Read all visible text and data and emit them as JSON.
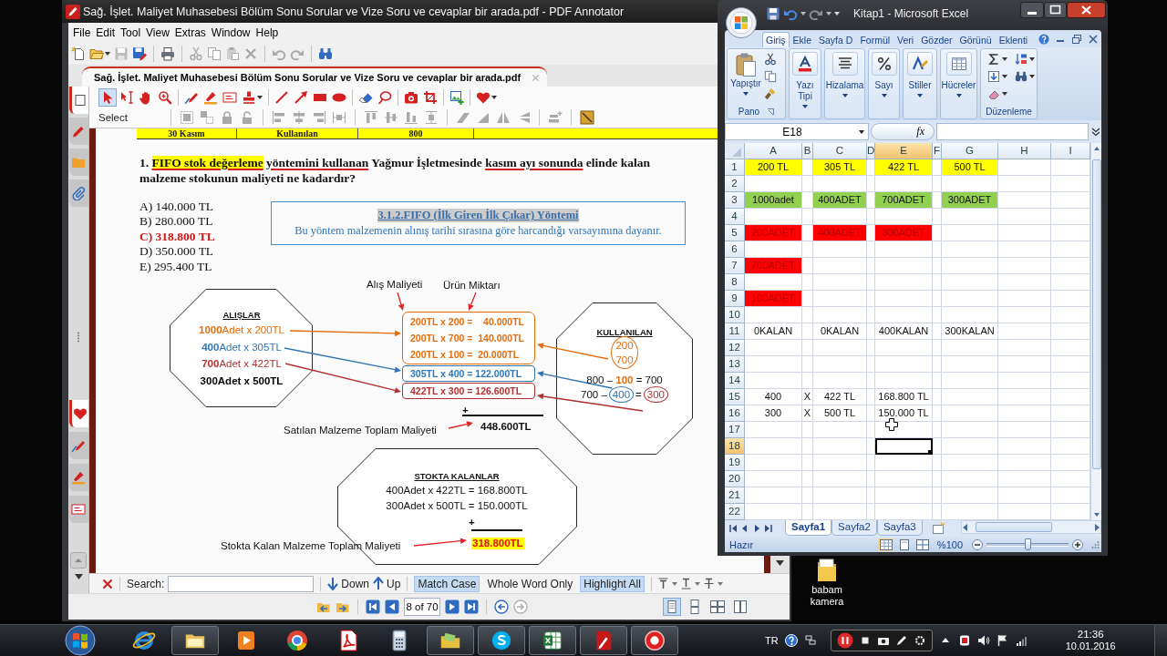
{
  "pdf_window": {
    "title": "Sağ. İşlet. Maliyet Muhasebesi Bölüm Sonu Sorular ve Vize Soru ve cevaplar bir arada.pdf - PDF Annotator",
    "menu": [
      "File",
      "Edit",
      "Tool",
      "View",
      "Extras",
      "Window",
      "Help"
    ],
    "toolbar": [
      {
        "kind": "new",
        "disabled": false,
        "dropdown": false
      },
      {
        "kind": "open",
        "disabled": false,
        "dropdown": true
      },
      {
        "kind": "save",
        "disabled": true,
        "dropdown": false
      },
      {
        "kind": "saveas",
        "disabled": false,
        "dropdown": false
      },
      {
        "kind": "separator"
      },
      {
        "kind": "print",
        "disabled": false,
        "dropdown": false
      },
      {
        "kind": "separator"
      },
      {
        "kind": "cut",
        "disabled": true,
        "dropdown": false
      },
      {
        "kind": "copy",
        "disabled": true,
        "dropdown": false
      },
      {
        "kind": "paste",
        "disabled": true,
        "dropdown": false
      },
      {
        "kind": "delete",
        "disabled": true,
        "dropdown": false
      },
      {
        "kind": "separator"
      },
      {
        "kind": "undo",
        "disabled": true,
        "dropdown": false
      },
      {
        "kind": "redo",
        "disabled": true,
        "dropdown": false
      },
      {
        "kind": "separator"
      },
      {
        "kind": "find",
        "disabled": false,
        "dropdown": false
      }
    ],
    "document_tab": "Sağ. İşlet. Maliyet Muhasebesi Bölüm Sonu Sorular ve Vize Soru ve cevaplar bir arada.pdf",
    "side_tabs": [
      {
        "kind": "page",
        "selected": true
      },
      {
        "kind": "marker",
        "selected": false
      },
      {
        "kind": "folder",
        "selected": false
      },
      {
        "kind": "clip",
        "selected": false
      }
    ],
    "side_tools": [
      {
        "kind": "heart",
        "selected": true
      },
      {
        "kind": "pen",
        "selected": false
      },
      {
        "kind": "highlighter",
        "selected": false
      },
      {
        "kind": "textbox",
        "selected": false
      }
    ],
    "tools": [
      {
        "kind": "pointer",
        "selected": true,
        "dropdown": false
      },
      {
        "kind": "textselect",
        "selected": false,
        "dropdown": false
      },
      {
        "kind": "hand",
        "selected": false,
        "dropdown": false
      },
      {
        "kind": "zoom",
        "selected": false,
        "dropdown": false
      },
      {
        "kind": "separator"
      },
      {
        "kind": "pen",
        "selected": false,
        "dropdown": false
      },
      {
        "kind": "highlighter",
        "selected": false,
        "dropdown": false
      },
      {
        "kind": "textbox",
        "selected": false,
        "dropdown": false
      },
      {
        "kind": "stamp",
        "selected": false,
        "dropdown": true
      },
      {
        "kind": "separator"
      },
      {
        "kind": "line",
        "selected": false,
        "dropdown": false
      },
      {
        "kind": "arrow",
        "selected": false,
        "dropdown": false
      },
      {
        "kind": "rect",
        "selected": false,
        "dropdown": false
      },
      {
        "kind": "ellipse",
        "selected": false,
        "dropdown": false
      },
      {
        "kind": "separator"
      },
      {
        "kind": "eraser",
        "selected": false,
        "dropdown": false
      },
      {
        "kind": "lasso",
        "selected": false,
        "dropdown": false
      },
      {
        "kind": "separator"
      },
      {
        "kind": "camera",
        "selected": false,
        "dropdown": false
      },
      {
        "kind": "crop",
        "selected": false,
        "dropdown": false
      },
      {
        "kind": "separator"
      },
      {
        "kind": "image",
        "selected": false,
        "dropdown": false
      },
      {
        "kind": "separator"
      },
      {
        "kind": "heart",
        "selected": false,
        "dropdown": true
      }
    ],
    "tool_label": "Select",
    "arrange_tools": [
      {
        "kind": "group",
        "disabled": true
      },
      {
        "kind": "ungroup",
        "disabled": true
      },
      {
        "kind": "lock",
        "disabled": true
      },
      {
        "kind": "unlock",
        "disabled": true
      },
      {
        "kind": "separator"
      },
      {
        "kind": "alignleft",
        "disabled": true
      },
      {
        "kind": "aligncenter",
        "disabled": true
      },
      {
        "kind": "alignright",
        "disabled": true
      },
      {
        "kind": "spaceh",
        "disabled": true
      },
      {
        "kind": "separator"
      },
      {
        "kind": "aligntop",
        "disabled": true
      },
      {
        "kind": "alignmiddle",
        "disabled": true
      },
      {
        "kind": "alignbottom",
        "disabled": true
      },
      {
        "kind": "spacev",
        "disabled": true
      },
      {
        "kind": "separator"
      },
      {
        "kind": "skewleft",
        "disabled": true
      },
      {
        "kind": "skewright",
        "disabled": true
      },
      {
        "kind": "fliph",
        "disabled": true
      },
      {
        "kind": "flipv",
        "disabled": true
      },
      {
        "kind": "separator"
      },
      {
        "kind": "layer",
        "disabled": true
      },
      {
        "kind": "separator"
      },
      {
        "kind": "resize",
        "disabled": false
      }
    ],
    "page": {
      "table_row": [
        "30 Kasım",
        "Kullanılan",
        "800"
      ],
      "question": [
        {
          "text": "1.",
          "kind": "plain"
        },
        {
          "text": "FIFO stok değerleme",
          "kind": "highlighted"
        },
        {
          "text": "yöntemini kullanan",
          "kind": "underlined"
        },
        {
          "text": "Yağmur İşletmesinde",
          "kind": "plain"
        },
        {
          "text": "kasım ayı sonunda",
          "kind": "underlined"
        },
        {
          "text": "elinde kalan malzeme stokunun maliyeti ne kadardır?",
          "kind": "plain"
        }
      ],
      "options": [
        {
          "text": "A) 140.000 TL",
          "correct": false
        },
        {
          "text": "B) 280.000 TL",
          "correct": false
        },
        {
          "text": "C) 318.800 TL",
          "correct": true
        },
        {
          "text": "D) 350.000 TL",
          "correct": false
        },
        {
          "text": "E) 295.400 TL",
          "correct": false
        }
      ],
      "info_box": {
        "title": "3.1.2.FIFO (İlk Giren İlk Çıkar) Yöntemi",
        "text": "Bu yöntem malzemenin alınış tarihi sırasına göre harcandığı varsayımına dayanır."
      },
      "diagram": {
        "headers": [
          "Alış Maliyeti",
          "Ürün Miktarı"
        ],
        "purchases": {
          "title": "ALIŞLAR",
          "lines": [
            {
              "text": "**1000**Adet x 200TL",
              "color": "#e46c0a",
              "bold": false
            },
            {
              "text": "**400**Adet x 305TL",
              "color": "#2e75b6",
              "bold": false
            },
            {
              "text": "**700**Adet x 422TL",
              "color": "#b03030",
              "bold": false
            },
            {
              "text": "300Adet x 500TL",
              "color": "#000000",
              "bold": true
            }
          ]
        },
        "cost_boxes": [
          {
            "color": "#e46c0a",
            "lines": [
              "200TL x 200 =    40.000TL",
              "200TL x 700 =  140.000TL",
              "200TL x 100 =  20.000TL"
            ]
          },
          {
            "color": "#2e75b6",
            "lines": [
              "305TL x 400 = 122.000TL"
            ]
          },
          {
            "color": "#b03030",
            "lines": [
              "422TL x 300 = 126.600TL"
            ]
          }
        ],
        "sold": {
          "plus": "+",
          "total": "448.600TL",
          "caption": "Satılan Malzeme Toplam Maliyeti"
        },
        "usage": {
          "title": "KULLANILAN",
          "circled": {
            "values": [
              "200",
              "700"
            ],
            "color": "#e46c0a"
          },
          "equations": [
            {
              "terms": [
                {
                  "text": "800 –",
                  "circled": false
                },
                {
                  "text": "100",
                  "color": "#e46c0a",
                  "circled": false
                },
                {
                  "text": "= 700",
                  "circled": false
                }
              ]
            },
            {
              "terms": [
                {
                  "text": "700 –",
                  "circled": false
                },
                {
                  "text": "400",
                  "color": "#2e75b6",
                  "circled": true
                },
                {
                  "text": "=",
                  "circled": false
                },
                {
                  "text": "300",
                  "color": "#b03030",
                  "circled": true
                }
              ]
            }
          ]
        },
        "stock": {
          "title": "STOKTA KALANLAR",
          "lines": [
            "400Adet x 422TL = 168.800TL",
            "300Adet x 500TL = 150.000TL"
          ],
          "plus": "+",
          "total": "318.800TL",
          "caption": "Stokta Kalan Malzeme Toplam Maliyeti"
        }
      }
    },
    "search": {
      "label": "Search:",
      "down": "Down",
      "up": "Up",
      "toggles": [
        {
          "label": "Match Case",
          "on": true
        },
        {
          "label": "Whole Word Only",
          "on": false
        },
        {
          "label": "Highlight All",
          "on": true
        }
      ]
    },
    "navigation": {
      "page": "8 of 70",
      "views": [
        {
          "kind": "single",
          "selected": true
        },
        {
          "kind": "continuous",
          "selected": false
        },
        {
          "kind": "facing",
          "selected": false
        },
        {
          "kind": "columns",
          "selected": false
        }
      ]
    }
  },
  "excel_window": {
    "title": "Kitap1 - Microsoft Excel",
    "tabs": [
      {
        "label": "Giriş",
        "selected": true
      },
      {
        "label": "Ekle",
        "selected": false
      },
      {
        "label": "Sayfa D",
        "selected": false
      },
      {
        "label": "Formül",
        "selected": false
      },
      {
        "label": "Veri",
        "selected": false
      },
      {
        "label": "Gözder",
        "selected": false
      },
      {
        "label": "Görünü",
        "selected": false
      },
      {
        "label": "Eklenti",
        "selected": false
      }
    ],
    "clipboard": {
      "paste": "Yapıştır",
      "label": "Pano"
    },
    "groups": [
      {
        "kind": "font",
        "label": "Yazı Tipi"
      },
      {
        "kind": "alignment",
        "label": "Hizalama"
      },
      {
        "kind": "number",
        "label": "Sayı"
      },
      {
        "kind": "styles",
        "label": "Stiller"
      },
      {
        "kind": "cells",
        "label": "Hücreler"
      }
    ],
    "editing": {
      "label": "Düzenleme"
    },
    "name_box": "E18",
    "function_button": "fx",
    "columns": [
      {
        "label": "A",
        "selected": false
      },
      {
        "label": "B",
        "selected": false
      },
      {
        "label": "C",
        "selected": false
      },
      {
        "label": "D",
        "selected": false
      },
      {
        "label": "E",
        "selected": true
      },
      {
        "label": "F",
        "selected": false
      },
      {
        "label": "G",
        "selected": false
      },
      {
        "label": "H",
        "selected": false
      },
      {
        "label": "I",
        "selected": false
      }
    ],
    "rows": [
      {
        "label": "1",
        "selected": false,
        "cells": [
          {
            "text": "200 TL",
            "color": "#ffff00"
          },
          {},
          {
            "text": "305 TL",
            "color": "#ffff00"
          },
          {},
          {
            "text": "422 TL",
            "color": "#ffff00"
          },
          {},
          {
            "text": "500 TL",
            "color": "#ffff00"
          }
        ]
      },
      {
        "label": "2",
        "selected": false
      },
      {
        "label": "3",
        "selected": false,
        "cells": [
          {
            "text": "1000adet",
            "color": "#92d050"
          },
          {},
          {
            "text": "400ADET",
            "color": "#92d050"
          },
          {},
          {
            "text": "700ADET",
            "color": "#92d050"
          },
          {},
          {
            "text": "300ADET",
            "color": "#92d050"
          }
        ]
      },
      {
        "label": "4",
        "selected": false
      },
      {
        "label": "5",
        "selected": false,
        "cells": [
          {
            "text": "200ADET",
            "color": "#ff0000"
          },
          {},
          {
            "text": "400ADET",
            "color": "#ff0000"
          },
          {},
          {
            "text": "300ADET",
            "color": "#ff0000"
          }
        ]
      },
      {
        "label": "6",
        "selected": false
      },
      {
        "label": "7",
        "selected": false,
        "cells": [
          {
            "text": "700ADET",
            "color": "#ff0000"
          }
        ]
      },
      {
        "label": "8",
        "selected": false
      },
      {
        "label": "9",
        "selected": false,
        "cells": [
          {
            "text": "100ADET",
            "color": "#ff0000"
          }
        ]
      },
      {
        "label": "10",
        "selected": false
      },
      {
        "label": "11",
        "selected": false,
        "cells": [
          {
            "text": "0KALAN"
          },
          {},
          {
            "text": "0KALAN"
          },
          {},
          {
            "text": "400KALAN"
          },
          {},
          {
            "text": "300KALAN"
          }
        ]
      },
      {
        "label": "12",
        "selected": false
      },
      {
        "label": "13",
        "selected": false
      },
      {
        "label": "14",
        "selected": false
      },
      {
        "label": "15",
        "selected": false,
        "cells": [
          {
            "text": "400"
          },
          {
            "text": "X"
          },
          {
            "text": "422 TL"
          },
          {},
          {
            "text": "168.800 TL"
          }
        ]
      },
      {
        "label": "16",
        "selected": false,
        "cells": [
          {
            "text": "300"
          },
          {
            "text": "X"
          },
          {
            "text": "500 TL"
          },
          {},
          {
            "text": "150.000 TL"
          }
        ]
      },
      {
        "label": "17",
        "selected": false
      },
      {
        "label": "18",
        "selected": true
      },
      {
        "label": "19",
        "selected": false
      },
      {
        "label": "20",
        "selected": false
      },
      {
        "label": "21",
        "selected": false
      },
      {
        "label": "22",
        "selected": false
      }
    ],
    "sheets": [
      {
        "label": "Sayfa1",
        "selected": true
      },
      {
        "label": "Sayfa2",
        "selected": false
      },
      {
        "label": "Sayfa3",
        "selected": false
      }
    ],
    "status": "Hazır",
    "views": [
      {
        "kind": "normal",
        "selected": true
      },
      {
        "kind": "layout",
        "selected": false
      },
      {
        "kind": "breaks",
        "selected": false
      }
    ],
    "zoom": {
      "label": "%100",
      "level": 0.5
    }
  },
  "desktop_icons": [
    {
      "label": "babam kamera"
    }
  ],
  "taskbar": {
    "apps": [
      {
        "kind": "browser",
        "running": false
      },
      {
        "kind": "explorer",
        "running": true
      },
      {
        "kind": "media",
        "running": false
      },
      {
        "kind": "chrome",
        "running": false
      },
      {
        "kind": "reader",
        "running": false
      },
      {
        "kind": "calculator",
        "running": false
      },
      {
        "kind": "library",
        "running": true
      },
      {
        "kind": "chat",
        "running": true
      },
      {
        "kind": "sheet",
        "running": true
      },
      {
        "kind": "annotator",
        "running": true
      },
      {
        "kind": "recorder",
        "running": true
      }
    ],
    "language": "TR",
    "time": "21:36",
    "date": "10.01.2016"
  }
}
